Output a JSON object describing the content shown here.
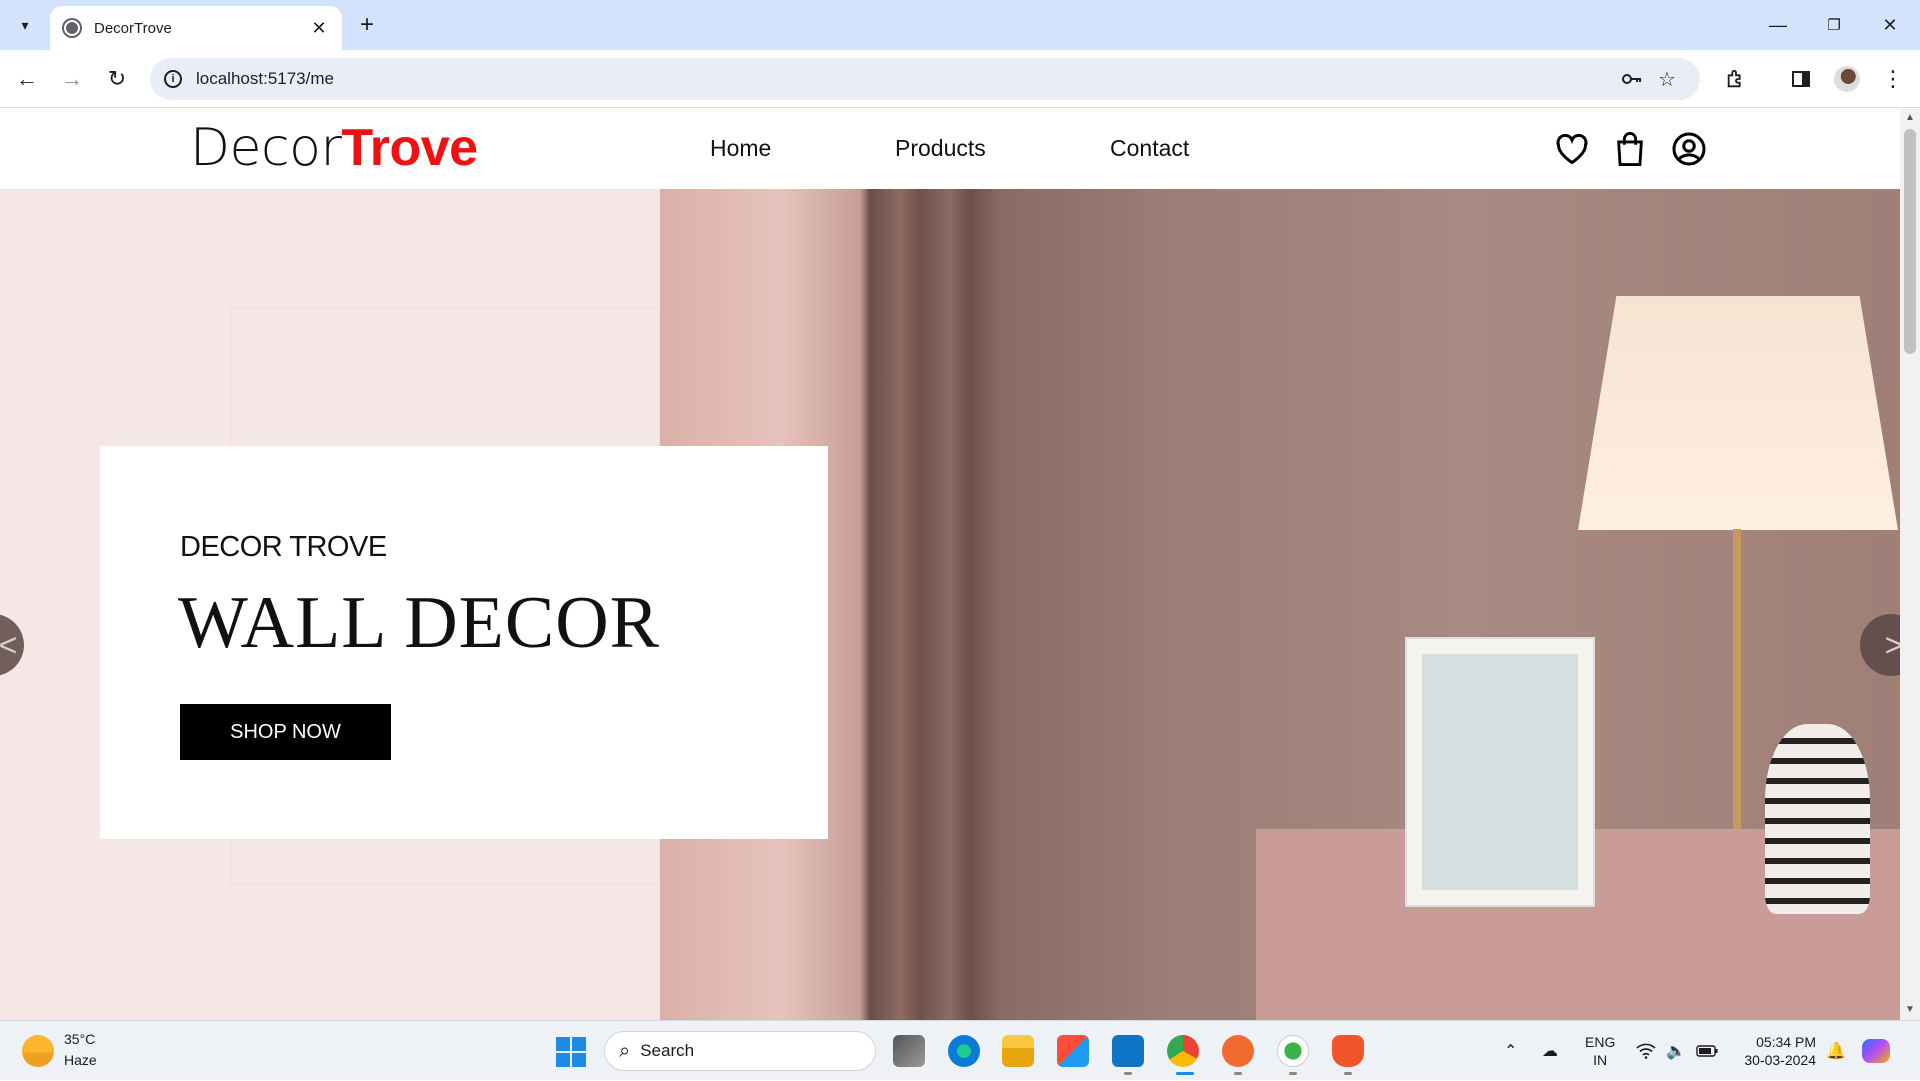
{
  "browser": {
    "tab_title": "DecorTrove",
    "tab_close": "✕",
    "new_tab": "+",
    "url": "localhost:5173/me",
    "window_controls": {
      "minimize": "—",
      "restore": "❐",
      "close": "✕"
    },
    "nav": {
      "back": "←",
      "forward": "→",
      "reload": "↻"
    }
  },
  "site": {
    "logo": {
      "part1": "Decor",
      "part2": "Trove"
    },
    "nav": [
      {
        "label": "Home"
      },
      {
        "label": "Products"
      },
      {
        "label": "Contact"
      }
    ],
    "icons": [
      "heart-icon",
      "shopping-bag-icon",
      "user-icon"
    ]
  },
  "hero": {
    "kicker": "DECOR TROVE",
    "title": "WALL DECOR",
    "cta": "SHOP NOW",
    "prev_arrow": "<",
    "next_arrow": ">"
  },
  "taskbar": {
    "weather": {
      "temp": "35°C",
      "condition": "Haze"
    },
    "search_placeholder": "Search",
    "language": {
      "line1": "ENG",
      "line2": "IN"
    },
    "clock": {
      "time": "05:34 PM",
      "date": "30-03-2024"
    }
  },
  "colors": {
    "accent_red": "#ee1111",
    "hero_left_bg": "#f5e7e5",
    "chrome_bg": "#d3e3fd"
  }
}
